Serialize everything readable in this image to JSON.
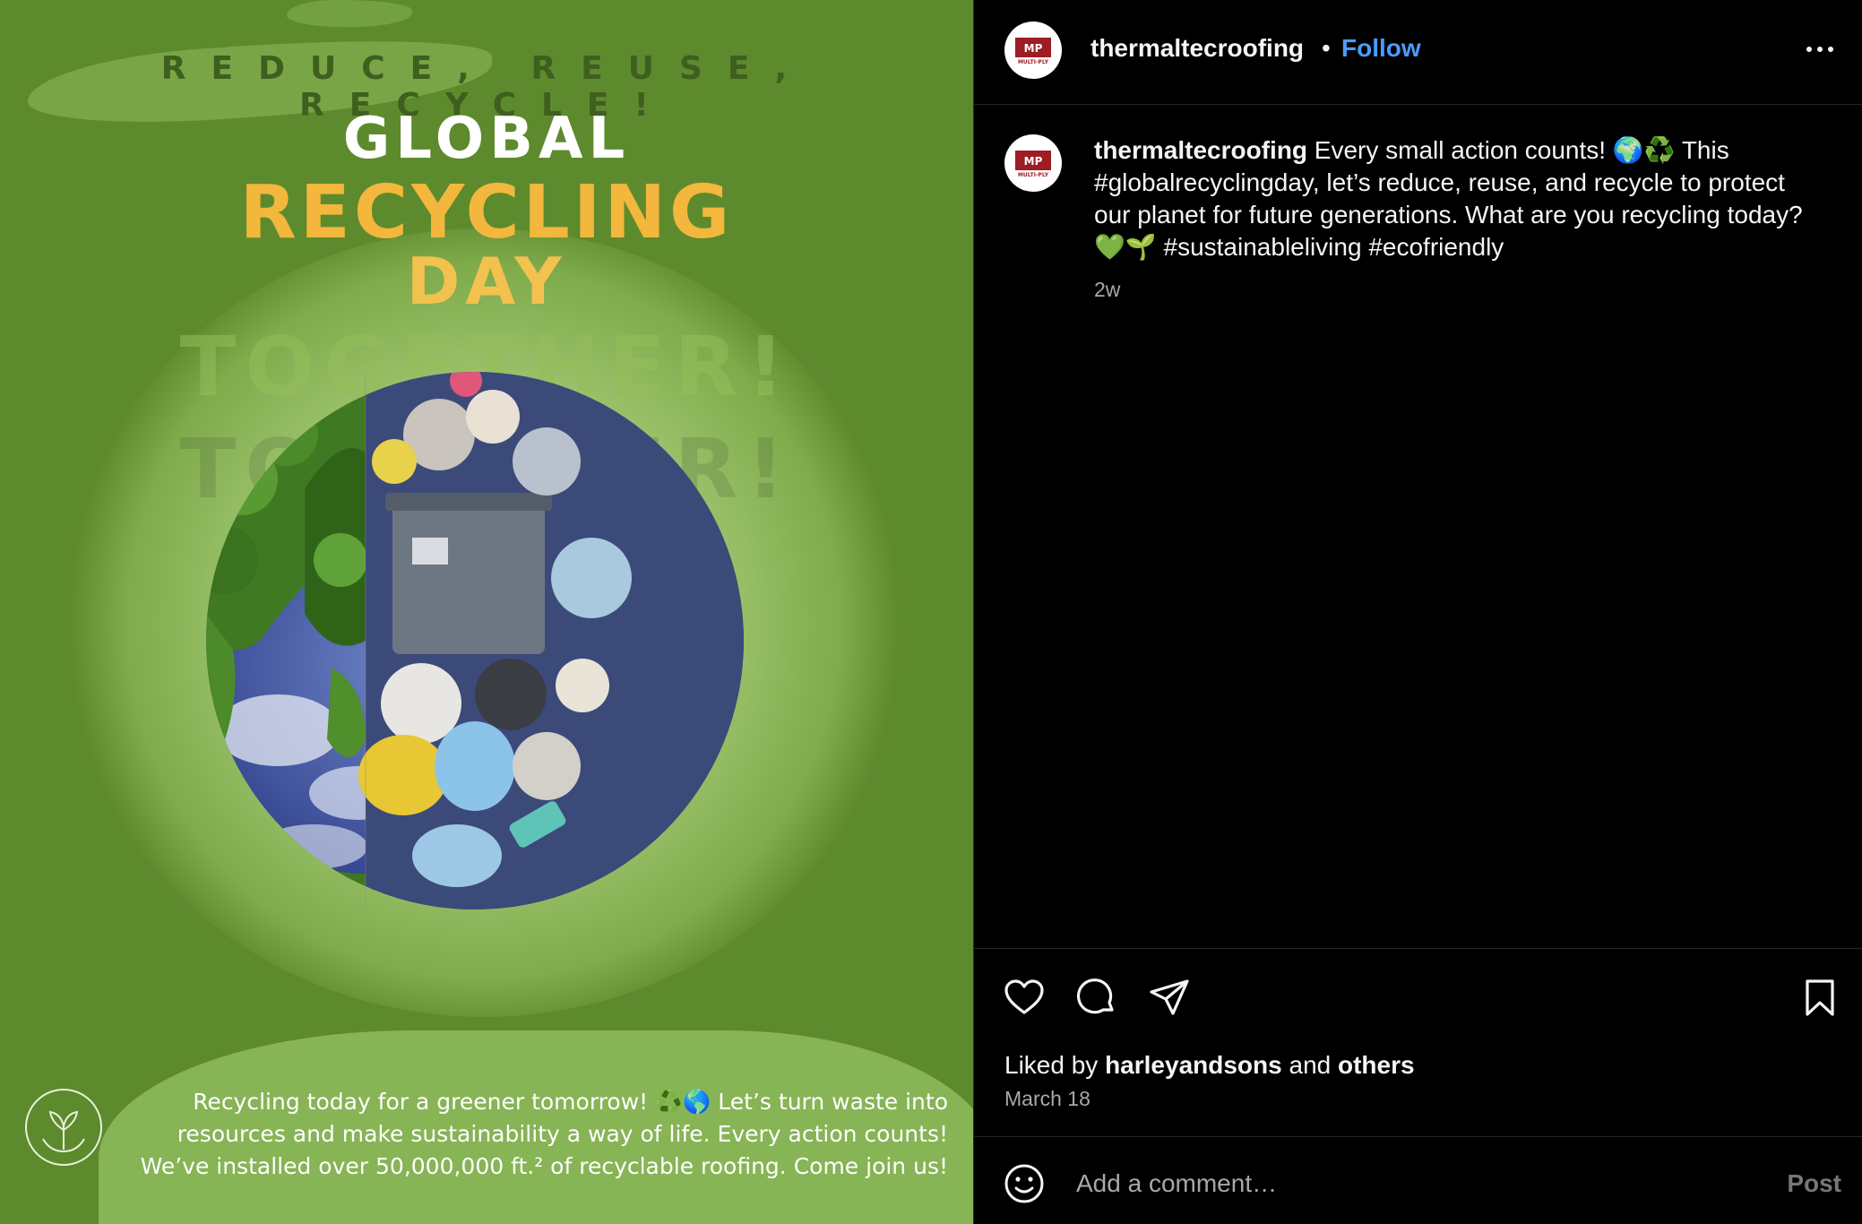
{
  "post_image": {
    "tagline": "REDUCE, REUSE, RECYCLE!",
    "title_line1": "GLOBAL",
    "title_line2": "RECYCLING",
    "title_line3": "DAY",
    "ghost_text": "TOGETHER!",
    "caption_line1": "Recycling today for a greener tomorrow! ♻️🌎 Let’s turn waste into",
    "caption_line2": "resources and make sustainability a way of life. Every action counts!",
    "caption_line3": "We’ve installed over 50,000,000 ft.² of recyclable roofing. Come join us!",
    "colors": {
      "background": "#5e8a2e",
      "title_white": "#ffffff",
      "title_gold": "#f2b73c"
    }
  },
  "header": {
    "username": "thermaltecroofing",
    "separator": "•",
    "follow_label": "Follow",
    "avatar_icon": "multi-ply-thermaltec-logo",
    "avatar_text": "MULTI-PLY"
  },
  "comment": {
    "username": "thermaltecroofing",
    "text": " Every small action counts! 🌍♻️ This #globalrecyclingday, let’s reduce, reuse, and recycle to protect our planet for future generations. What are you recycling today? 💚🌱 #sustainableliving #ecofriendly",
    "time": "2w"
  },
  "actions": {
    "liked_prefix": "Liked by ",
    "liked_user": "harleyandsons",
    "liked_middle": " and ",
    "liked_others": "others",
    "date": "March 18"
  },
  "add_comment": {
    "placeholder": "Add a comment…",
    "post_label": "Post"
  },
  "theme": {
    "panel_bg": "#000000",
    "text": "#f5f5f5",
    "muted": "#a8a8a8",
    "link_blue": "#4a9df8",
    "divider": "#262626"
  }
}
